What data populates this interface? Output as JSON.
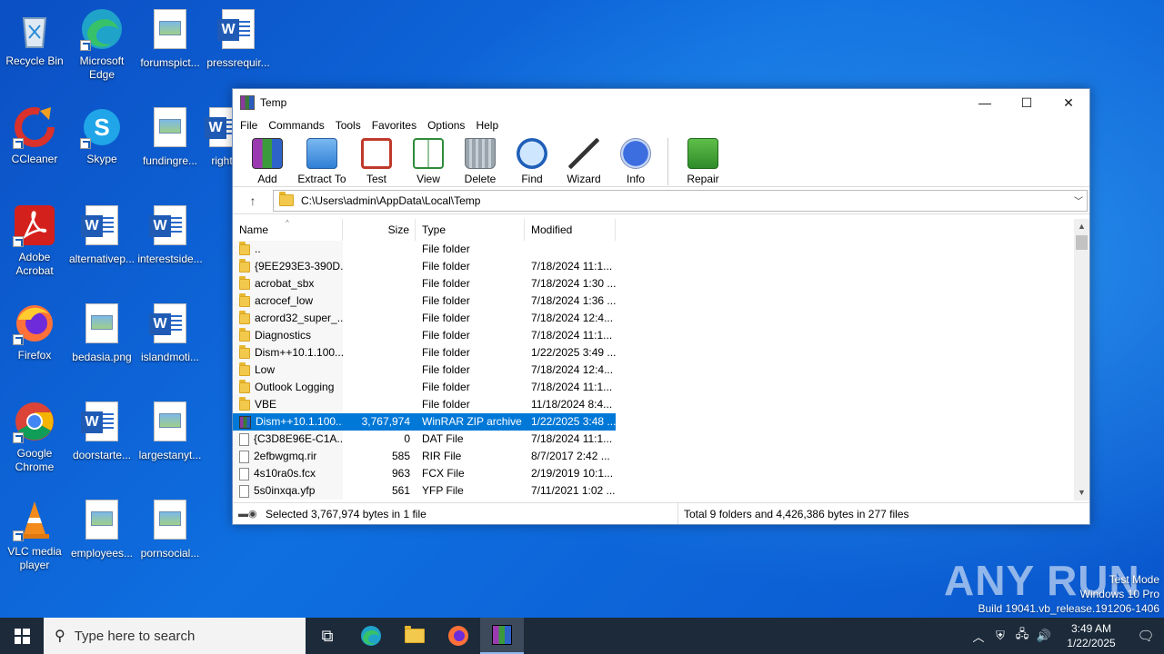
{
  "desktop": {
    "icons": [
      {
        "label": "Recycle Bin"
      },
      {
        "label": "Microsoft Edge"
      },
      {
        "label": "forumspict..."
      },
      {
        "label": "pressrequir..."
      },
      {
        "label": "CCleaner"
      },
      {
        "label": "Skype"
      },
      {
        "label": "fundingre..."
      },
      {
        "label": "right"
      },
      {
        "label": "Adobe Acrobat"
      },
      {
        "label": "alternativep..."
      },
      {
        "label": "interestside..."
      },
      {
        "label": "Firefox"
      },
      {
        "label": "bedasia.png"
      },
      {
        "label": "islandmoti..."
      },
      {
        "label": "Google Chrome"
      },
      {
        "label": "doorstarte..."
      },
      {
        "label": "largestanyt..."
      },
      {
        "label": "VLC media player"
      },
      {
        "label": "employees..."
      },
      {
        "label": "pornsocial..."
      }
    ]
  },
  "window": {
    "title": "Temp",
    "controls": {
      "minimize": "—",
      "maximize": "☐",
      "close": "✕"
    },
    "menu": [
      "File",
      "Commands",
      "Tools",
      "Favorites",
      "Options",
      "Help"
    ],
    "toolbar": [
      {
        "label": "Add",
        "icon": "add-archive-icon"
      },
      {
        "label": "Extract To",
        "icon": "extract-folder-icon"
      },
      {
        "label": "Test",
        "icon": "test-clipboard-icon"
      },
      {
        "label": "View",
        "icon": "view-book-icon"
      },
      {
        "label": "Delete",
        "icon": "trash-icon"
      },
      {
        "label": "Find",
        "icon": "magnifier-icon"
      },
      {
        "label": "Wizard",
        "icon": "wand-icon"
      },
      {
        "label": "Info",
        "icon": "info-icon"
      },
      {
        "label": "Repair",
        "icon": "repair-kit-icon"
      }
    ],
    "address": {
      "path": "C:\\Users\\admin\\AppData\\Local\\Temp"
    },
    "columns": {
      "name": "Name",
      "size": "Size",
      "type": "Type",
      "modified": "Modified"
    },
    "files": [
      {
        "name": "..",
        "size": "",
        "type": "File folder",
        "modified": "",
        "kind": "folder"
      },
      {
        "name": "{9EE293E3-390D...",
        "size": "",
        "type": "File folder",
        "modified": "7/18/2024 11:1...",
        "kind": "folder"
      },
      {
        "name": "acrobat_sbx",
        "size": "",
        "type": "File folder",
        "modified": "7/18/2024 1:30 ...",
        "kind": "folder"
      },
      {
        "name": "acrocef_low",
        "size": "",
        "type": "File folder",
        "modified": "7/18/2024 1:36 ...",
        "kind": "folder"
      },
      {
        "name": "acrord32_super_...",
        "size": "",
        "type": "File folder",
        "modified": "7/18/2024 12:4...",
        "kind": "folder"
      },
      {
        "name": "Diagnostics",
        "size": "",
        "type": "File folder",
        "modified": "7/18/2024 11:1...",
        "kind": "folder"
      },
      {
        "name": "Dism++10.1.100...",
        "size": "",
        "type": "File folder",
        "modified": "1/22/2025 3:49 ...",
        "kind": "folder"
      },
      {
        "name": "Low",
        "size": "",
        "type": "File folder",
        "modified": "7/18/2024 12:4...",
        "kind": "folder"
      },
      {
        "name": "Outlook Logging",
        "size": "",
        "type": "File folder",
        "modified": "7/18/2024 11:1...",
        "kind": "folder"
      },
      {
        "name": "VBE",
        "size": "",
        "type": "File folder",
        "modified": "11/18/2024 8:4...",
        "kind": "folder"
      },
      {
        "name": "Dism++10.1.100...",
        "size": "3,767,974",
        "type": "WinRAR ZIP archive",
        "modified": "1/22/2025 3:48 ...",
        "kind": "zip",
        "selected": true
      },
      {
        "name": "{C3D8E96E-C1A...",
        "size": "0",
        "type": "DAT File",
        "modified": "7/18/2024 11:1...",
        "kind": "file"
      },
      {
        "name": "2efbwgmq.rir",
        "size": "585",
        "type": "RIR File",
        "modified": "8/7/2017 2:42 ...",
        "kind": "file"
      },
      {
        "name": "4s10ra0s.fcx",
        "size": "963",
        "type": "FCX File",
        "modified": "2/19/2019 10:1...",
        "kind": "file"
      },
      {
        "name": "5s0inxqa.yfp",
        "size": "561",
        "type": "YFP File",
        "modified": "7/11/2021 1:02 ...",
        "kind": "file"
      }
    ],
    "status": {
      "left": "Selected 3,767,974 bytes in 1 file",
      "right": "Total 9 folders and 4,426,386 bytes in 277 files"
    }
  },
  "taskbar": {
    "search_placeholder": "Type here to search",
    "time": "3:49 AM",
    "date": "1/22/2025"
  },
  "watermark": {
    "brand": "ANY RUN",
    "line1": "Test Mode",
    "line2": "Windows 10 Pro",
    "line3": "Build 19041.vb_release.191206-1406"
  }
}
